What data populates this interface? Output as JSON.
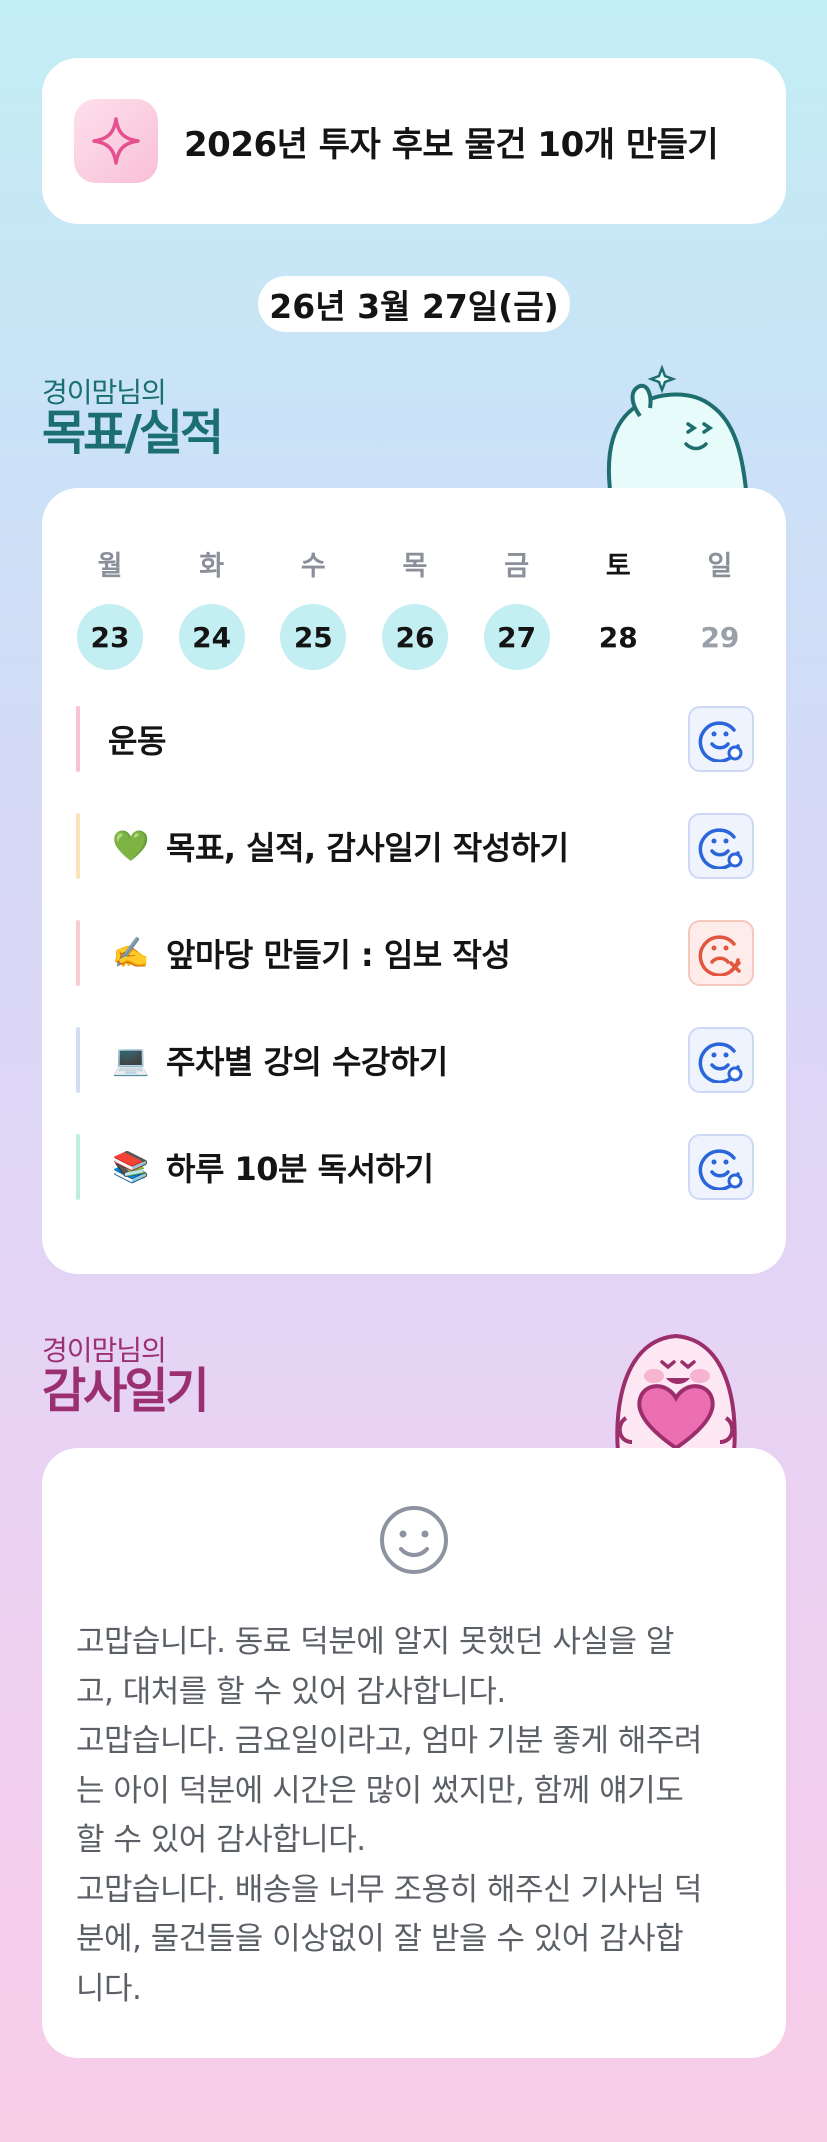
{
  "goal": {
    "icon": "sparkle-icon",
    "text": "2026년 투자 후보 물건 10개 만들기"
  },
  "date": "26년 3월 27일(금)",
  "goals_section": {
    "small_title": "경이맘님의",
    "big_title": "목표/실적"
  },
  "week": {
    "days": [
      {
        "name": "월",
        "num": "23",
        "state": "done"
      },
      {
        "name": "화",
        "num": "24",
        "state": "done"
      },
      {
        "name": "수",
        "num": "25",
        "state": "done"
      },
      {
        "name": "목",
        "num": "26",
        "state": "done"
      },
      {
        "name": "금",
        "num": "27",
        "state": "done"
      },
      {
        "name": "토",
        "num": "28",
        "state": "today"
      },
      {
        "name": "일",
        "num": "29",
        "state": "future"
      }
    ]
  },
  "tasks": [
    {
      "emoji": "",
      "label": "운동",
      "status": "done",
      "bar_color": "#f7c2d6"
    },
    {
      "emoji": "💚",
      "label": "목표, 실적, 감사일기 작성하기",
      "status": "done",
      "bar_color": "#fbe3b7"
    },
    {
      "emoji": "✍️",
      "label": "앞마당 만들기 : 임보 작성",
      "status": "fail",
      "bar_color": "#f8cdd2"
    },
    {
      "emoji": "💻",
      "label": "주차별 강의 수강하기",
      "status": "done",
      "bar_color": "#d3dcf0"
    },
    {
      "emoji": "📚",
      "label": "하루 10분 독서하기",
      "status": "done",
      "bar_color": "#bfeedd"
    }
  ],
  "diary_section": {
    "small_title": "경이맘님의",
    "big_title": "감사일기"
  },
  "diary": {
    "icon": "smile-face-icon",
    "lines": [
      "고맙습니다. 동료 덕분에 알지 못했던 사실을 알",
      "고, 대처를 할 수 있어 감사합니다.",
      "고맙습니다. 금요일이라고, 엄마 기분 좋게 해주려",
      "는 아이 덕분에 시간은 많이 썼지만, 함께 얘기도",
      "할 수 있어 감사합니다.",
      "고맙습니다. 배송을 너무 조용히 해주신 기사님 덕",
      "분에, 물건들을 이상없이 잘 받을 수 있어 감사합",
      "니다."
    ]
  },
  "colors": {
    "done_circle": "#c3eef2",
    "status_blue": "#2a66d9",
    "status_red": "#e2563f",
    "title_teal": "#1b6f73",
    "title_pink": "#9b3070"
  }
}
